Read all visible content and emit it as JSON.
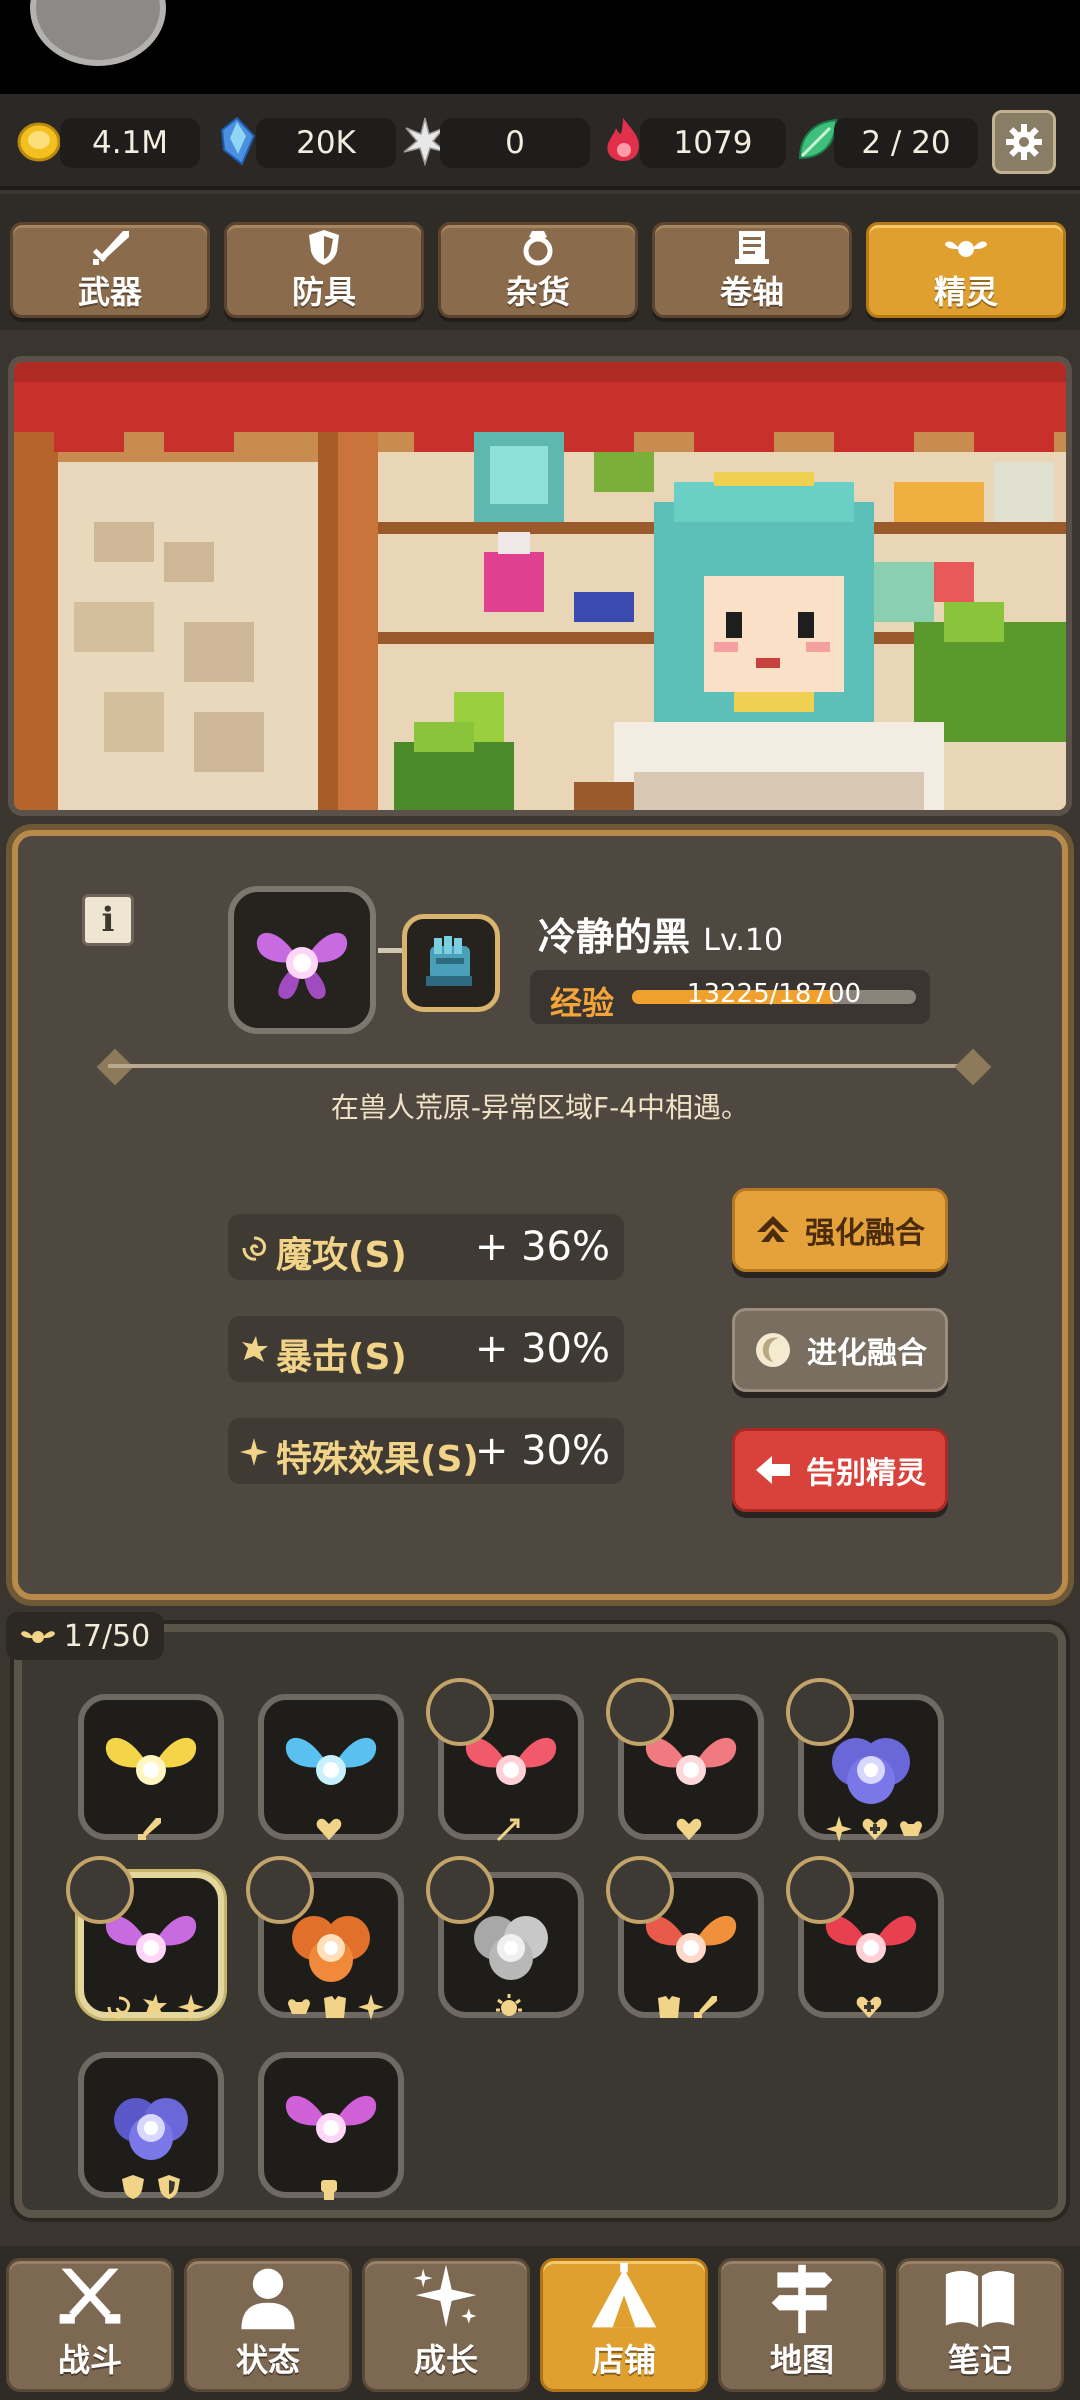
{
  "currencies": [
    {
      "icon": "gold-coin-icon",
      "value": "4.1M",
      "color": "#f4c020"
    },
    {
      "icon": "blue-crystal-icon",
      "value": "20K",
      "color": "#4a8fe0"
    },
    {
      "icon": "white-star-icon",
      "value": "0",
      "color": "#e8e8e8"
    },
    {
      "icon": "red-flame-icon",
      "value": "1079",
      "color": "#e0304a"
    },
    {
      "icon": "green-leaf-icon",
      "value": "2 / 20",
      "color": "#3fc07a"
    }
  ],
  "tabs": [
    {
      "label": "武器",
      "icon": "sword-icon"
    },
    {
      "label": "防具",
      "icon": "shield-icon"
    },
    {
      "label": "杂货",
      "icon": "ring-icon"
    },
    {
      "label": "卷轴",
      "icon": "scroll-icon"
    },
    {
      "label": "精灵",
      "icon": "spirit-icon",
      "active": true
    }
  ],
  "spirit": {
    "info": "i",
    "name": "冷静的黑",
    "level": "Lv.10",
    "exp_label": "经验",
    "exp_text": "13225/18700",
    "exp_progress": 0.707,
    "location": "在兽人荒原-异常区域F-4中相遇。",
    "stats": [
      {
        "name": "魔攻(S)",
        "value": "+ 36%",
        "icon": "magic-swirl-icon"
      },
      {
        "name": "暴击(S)",
        "value": "+ 30%",
        "icon": "crit-burst-icon"
      },
      {
        "name": "特殊效果(S)",
        "value": "+ 30%",
        "icon": "sparkle-icon"
      }
    ]
  },
  "actions": {
    "enhance": "强化融合",
    "evolve": "进化融合",
    "release": "告别精灵"
  },
  "inventory": {
    "count": "17/50",
    "colors": {
      "yellow": "#f4d54a",
      "blue": "#5ac0f0",
      "red": "#f05a6a",
      "purple": "#c86ae0",
      "violet": "#7a78e8",
      "orange": "#f08a3a",
      "white": "#d8d8d8"
    }
  },
  "nav": [
    {
      "label": "战斗",
      "icon": "crossed-swords-icon"
    },
    {
      "label": "状态",
      "icon": "person-icon"
    },
    {
      "label": "成长",
      "icon": "growth-star-icon"
    },
    {
      "label": "店铺",
      "icon": "tent-icon",
      "active": true
    },
    {
      "label": "地图",
      "icon": "signpost-icon"
    },
    {
      "label": "笔记",
      "icon": "book-icon"
    }
  ]
}
